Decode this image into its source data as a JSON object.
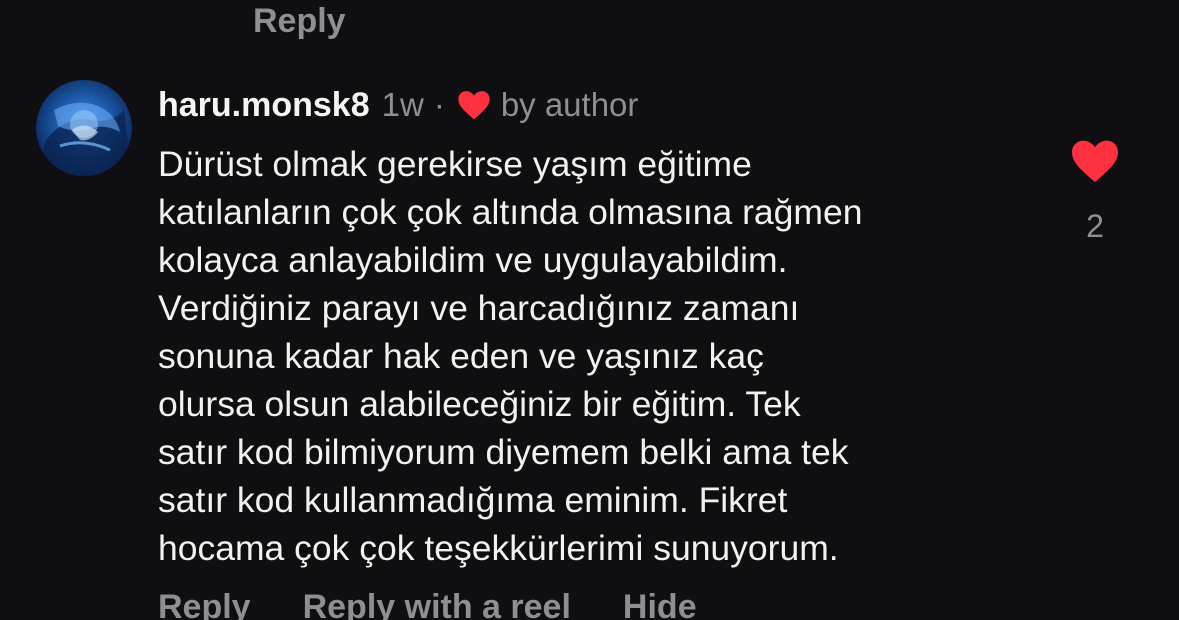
{
  "previous": {
    "reply_label": "Reply"
  },
  "comment": {
    "username": "haru.monsk8",
    "time": "1w",
    "separator": "·",
    "author_like_text": "by author",
    "lines": [
      "Dürüst olmak gerekirse yaşım eğitime",
      "katılanların çok çok altında olmasına rağmen",
      "kolayca anlayabildim ve uygulayabildim.",
      "Verdiğiniz parayı ve harcadığınız zamanı",
      "sonuna kadar hak eden ve yaşınız kaç",
      "olursa olsun alabileceğiniz bir eğitim. Tek",
      "satır kod bilmiyorum diyemem belki ama tek",
      "satır kod kullanmadığıma eminim. Fikret",
      "hocama çok çok teşekkürlerimi sunuyorum."
    ],
    "like_count": "2",
    "liked": true,
    "actions": {
      "reply": "Reply",
      "reply_with_reel": "Reply with a reel",
      "hide": "Hide"
    }
  },
  "colors": {
    "background": "#0f0f11",
    "heart": "#ff3040",
    "muted_text": "#8e8e93",
    "primary_text": "#f2f2f2"
  },
  "icons": {
    "author_like": "heart-icon",
    "like_button": "heart-filled-icon"
  }
}
